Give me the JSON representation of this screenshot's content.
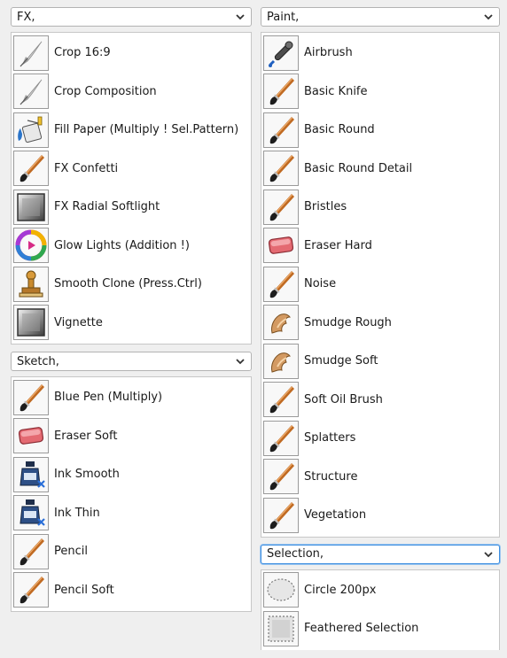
{
  "left": {
    "fx": {
      "dropdown_label": "FX,",
      "items": [
        {
          "label": "Crop 16:9",
          "icon": "quill-icon"
        },
        {
          "label": "Crop Composition",
          "icon": "quill-icon"
        },
        {
          "label": "Fill Paper (Multiply ! Sel.Pattern)",
          "icon": "paint-bucket-icon"
        },
        {
          "label": "FX Confetti",
          "icon": "brush-icon"
        },
        {
          "label": "FX Radial Softlight",
          "icon": "gradient-square-icon"
        },
        {
          "label": "Glow Lights (Addition !)",
          "icon": "color-wheel-icon"
        },
        {
          "label": "Smooth Clone (Press.Ctrl)",
          "icon": "stamp-icon"
        },
        {
          "label": "Vignette",
          "icon": "gradient-square-icon"
        }
      ]
    },
    "sketch": {
      "dropdown_label": "Sketch,",
      "items": [
        {
          "label": "Blue Pen (Multiply)",
          "icon": "brush-icon"
        },
        {
          "label": "Eraser Soft",
          "icon": "eraser-icon"
        },
        {
          "label": "Ink Smooth",
          "icon": "ink-bottle-icon"
        },
        {
          "label": "Ink Thin",
          "icon": "ink-bottle-icon"
        },
        {
          "label": "Pencil",
          "icon": "brush-icon"
        },
        {
          "label": "Pencil Soft",
          "icon": "brush-icon"
        }
      ]
    }
  },
  "right": {
    "paint": {
      "dropdown_label": "Paint,",
      "items": [
        {
          "label": "Airbrush",
          "icon": "airbrush-icon"
        },
        {
          "label": "Basic Knife",
          "icon": "brush-icon"
        },
        {
          "label": "Basic Round",
          "icon": "brush-icon"
        },
        {
          "label": "Basic Round Detail",
          "icon": "brush-icon"
        },
        {
          "label": "Bristles",
          "icon": "brush-icon"
        },
        {
          "label": "Eraser Hard",
          "icon": "eraser-icon"
        },
        {
          "label": "Noise",
          "icon": "brush-icon"
        },
        {
          "label": "Smudge Rough",
          "icon": "smudge-icon"
        },
        {
          "label": "Smudge Soft",
          "icon": "smudge-icon"
        },
        {
          "label": "Soft Oil Brush",
          "icon": "brush-icon"
        },
        {
          "label": "Splatters",
          "icon": "brush-icon"
        },
        {
          "label": "Structure",
          "icon": "brush-icon"
        },
        {
          "label": "Vegetation",
          "icon": "brush-icon"
        }
      ]
    },
    "selection": {
      "dropdown_label": "Selection,",
      "items": [
        {
          "label": "Circle 200px",
          "icon": "circle-selection-icon"
        },
        {
          "label": "Feathered Selection",
          "icon": "square-selection-icon"
        }
      ]
    }
  },
  "colors": {
    "focus_border": "#3d8ee0",
    "brush_wood": "#c06a22",
    "eraser": "#e46a72"
  }
}
